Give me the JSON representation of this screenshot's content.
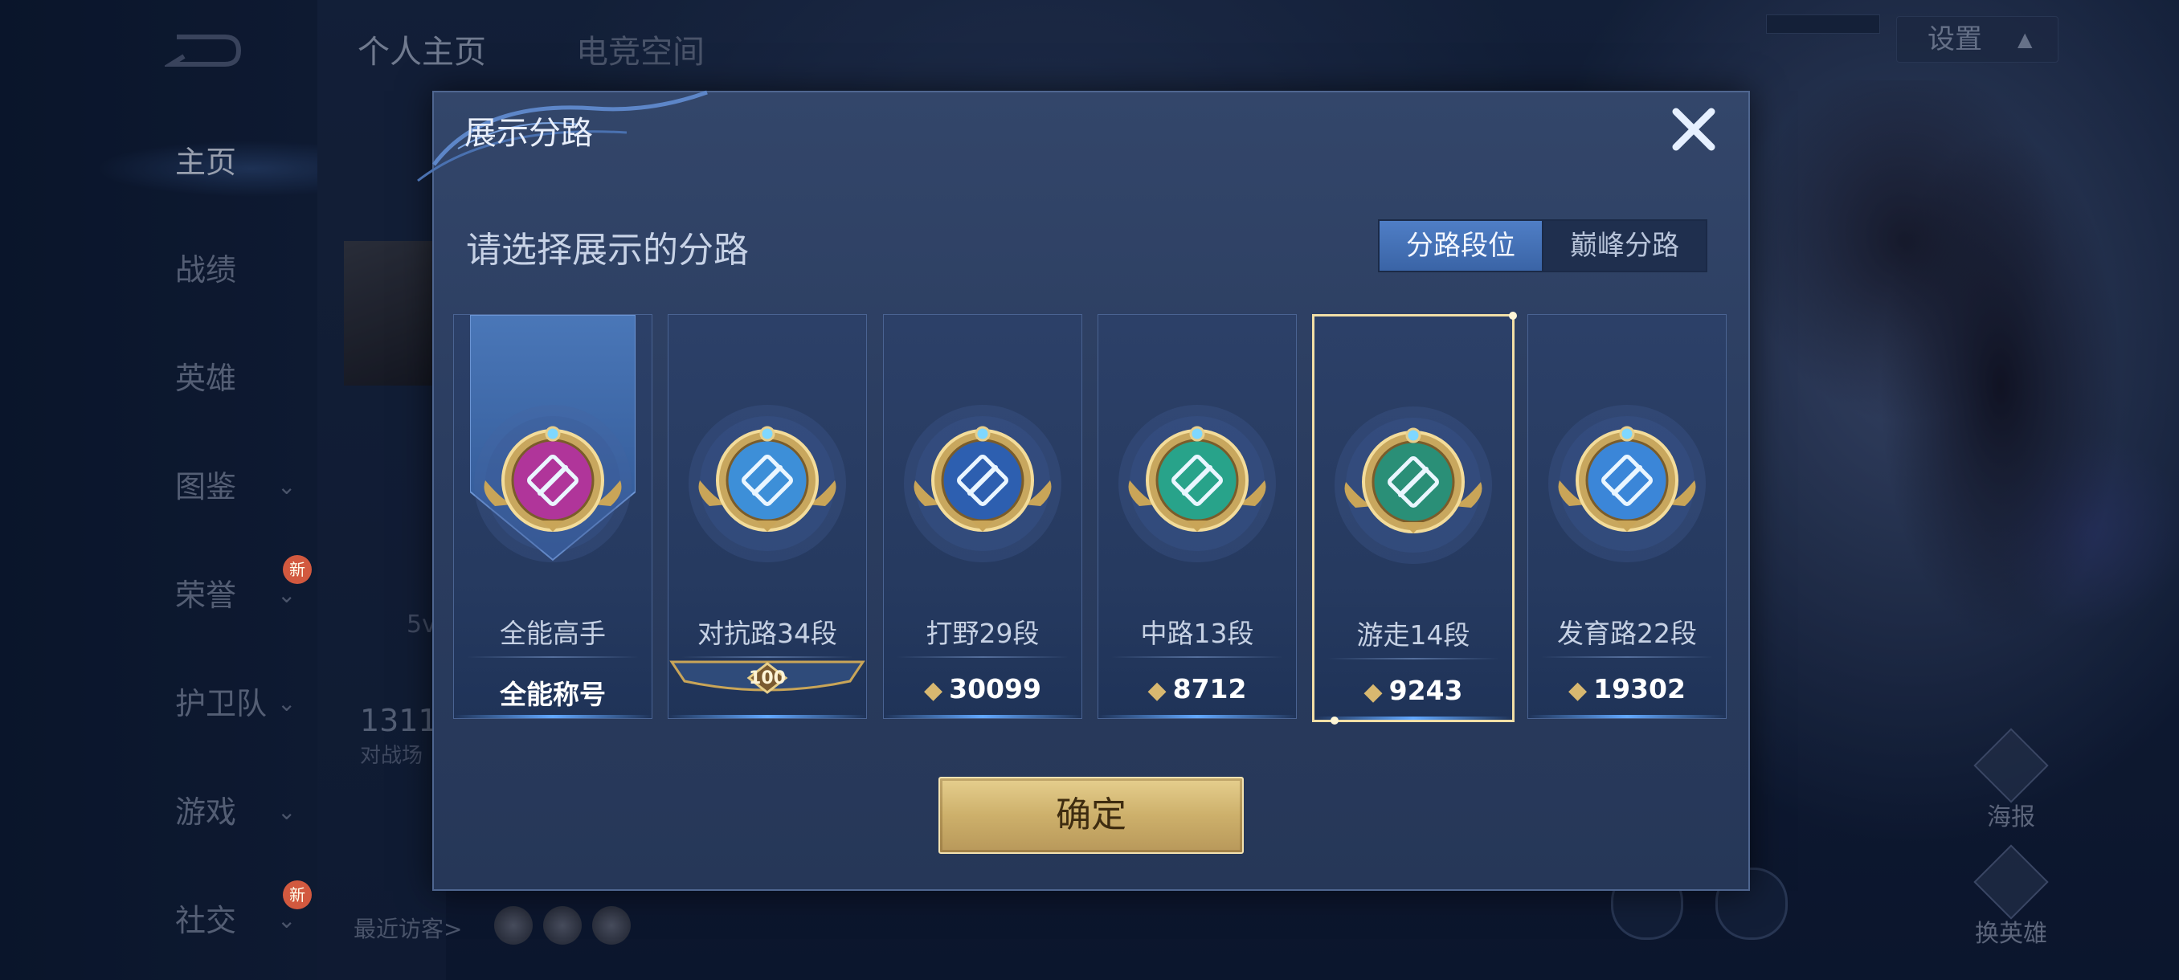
{
  "background": {
    "top_tabs": [
      "个人主页",
      "电竞空间"
    ],
    "settings_label": "设置",
    "sidebar_items": [
      {
        "label": "主页",
        "active": true,
        "expand": false
      },
      {
        "label": "战绩",
        "active": false,
        "expand": false
      },
      {
        "label": "英雄",
        "active": false,
        "expand": false
      },
      {
        "label": "图鉴",
        "active": false,
        "expand": true
      },
      {
        "label": "荣誉",
        "active": false,
        "expand": true,
        "badge": "新"
      },
      {
        "label": "护卫队",
        "active": false,
        "expand": true
      },
      {
        "label": "游戏",
        "active": false,
        "expand": true
      },
      {
        "label": "社交",
        "active": false,
        "expand": true,
        "badge": "新"
      }
    ],
    "stat_number": "1311",
    "stat_label": "对战场",
    "level_text": "5v",
    "recent_visitors": "最近访客>",
    "side_buttons": [
      "海报",
      "换英雄"
    ]
  },
  "modal": {
    "title": "展示分路",
    "subtitle": "请选择展示的分路",
    "toggle": {
      "rank": "分路段位",
      "peak": "巅峰分路",
      "selected": "rank"
    },
    "cards": [
      {
        "title": "全能高手",
        "value": "全能称号",
        "kind": "title",
        "emblem": "all-round-emblem-icon",
        "color": "#b0359a"
      },
      {
        "title": "对抗路34段",
        "value": "100",
        "kind": "rank-badge",
        "emblem": "clash-lane-emblem-icon",
        "color": "#3d8fd8"
      },
      {
        "title": "打野29段",
        "value": "30099",
        "kind": "points",
        "emblem": "jungle-emblem-icon",
        "color": "#2d5fb0"
      },
      {
        "title": "中路13段",
        "value": "8712",
        "kind": "points",
        "emblem": "mid-lane-emblem-icon",
        "color": "#28a38a"
      },
      {
        "title": "游走14段",
        "value": "9243",
        "kind": "points",
        "emblem": "roam-emblem-icon",
        "color": "#2a8f77",
        "selected": true
      },
      {
        "title": "发育路22段",
        "value": "19302",
        "kind": "points",
        "emblem": "farm-lane-emblem-icon",
        "color": "#3b86d8"
      }
    ],
    "confirm_label": "确定",
    "colors": {
      "gold": "#d8b870",
      "selected_border": "#f2dfa6",
      "toggle_active": "#4f7ec6"
    }
  }
}
